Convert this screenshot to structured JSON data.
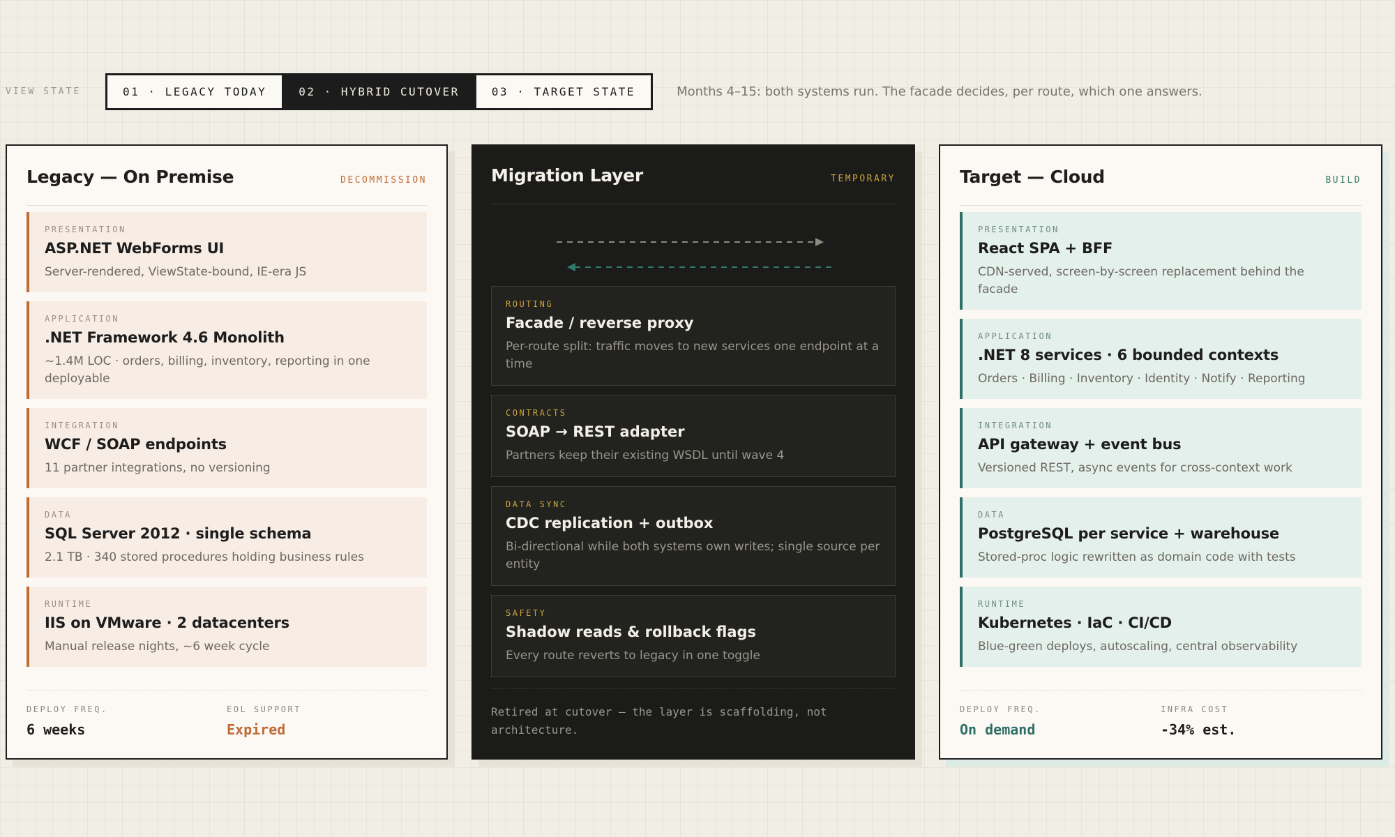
{
  "view": {
    "label": "VIEW STATE",
    "segments": [
      {
        "label": "01 · LEGACY TODAY",
        "active": false
      },
      {
        "label": "02 · HYBRID CUTOVER",
        "active": true
      },
      {
        "label": "03 · TARGET STATE",
        "active": false
      }
    ],
    "description": "Months 4–15: both systems run. The facade decides, per route, which one answers."
  },
  "legacy": {
    "title": "Legacy — On Premise",
    "tag": "DECOMMISSION",
    "layers": [
      {
        "kicker": "PRESENTATION",
        "title": "ASP.NET WebForms UI",
        "desc": "Server-rendered, ViewState-bound, IE-era JS"
      },
      {
        "kicker": "APPLICATION",
        "title": ".NET Framework 4.6 Monolith",
        "desc": "~1.4M LOC · orders, billing, inventory, reporting in one deployable"
      },
      {
        "kicker": "INTEGRATION",
        "title": "WCF / SOAP endpoints",
        "desc": "11 partner integrations, no versioning"
      },
      {
        "kicker": "DATA",
        "title": "SQL Server 2012 · single schema",
        "desc": "2.1 TB · 340 stored procedures holding business rules"
      },
      {
        "kicker": "RUNTIME",
        "title": "IIS on VMware · 2 datacenters",
        "desc": "Manual release nights, ~6 week cycle"
      }
    ],
    "stats": [
      {
        "label": "DEPLOY FREQ.",
        "value": "6 weeks"
      },
      {
        "label": "EOL SUPPORT",
        "value": "Expired"
      }
    ]
  },
  "migration": {
    "title": "Migration Layer",
    "tag": "TEMPORARY",
    "arrow_colors": {
      "forward": "#8d8a82",
      "back": "#2f7a6e"
    },
    "cards": [
      {
        "kicker": "ROUTING",
        "title": "Facade / reverse proxy",
        "desc": "Per-route split: traffic moves to new services one endpoint at a time"
      },
      {
        "kicker": "CONTRACTS",
        "title": "SOAP → REST adapter",
        "desc": "Partners keep their existing WSDL until wave 4"
      },
      {
        "kicker": "DATA SYNC",
        "title": "CDC replication + outbox",
        "desc": "Bi-directional while both systems own writes; single source per entity"
      },
      {
        "kicker": "SAFETY",
        "title": "Shadow reads & rollback flags",
        "desc": "Every route reverts to legacy in one toggle"
      }
    ],
    "note": "Retired at cutover — the layer is scaffolding, not architecture."
  },
  "target": {
    "title": "Target — Cloud",
    "tag": "BUILD",
    "layers": [
      {
        "kicker": "PRESENTATION",
        "title": "React SPA + BFF",
        "desc": "CDN-served, screen-by-screen replacement behind the facade"
      },
      {
        "kicker": "APPLICATION",
        "title": ".NET 8 services · 6 bounded contexts",
        "desc": "Orders · Billing · Inventory · Identity · Notify · Reporting"
      },
      {
        "kicker": "INTEGRATION",
        "title": "API gateway + event bus",
        "desc": "Versioned REST, async events for cross-context work"
      },
      {
        "kicker": "DATA",
        "title": "PostgreSQL per service + warehouse",
        "desc": "Stored-proc logic rewritten as domain code with tests"
      },
      {
        "kicker": "RUNTIME",
        "title": "Kubernetes · IaC · CI/CD",
        "desc": "Blue-green deploys, autoscaling, central observability"
      }
    ],
    "stats": [
      {
        "label": "DEPLOY FREQ.",
        "value": "On demand"
      },
      {
        "label": "INFRA COST",
        "value": "-34% est."
      }
    ]
  }
}
